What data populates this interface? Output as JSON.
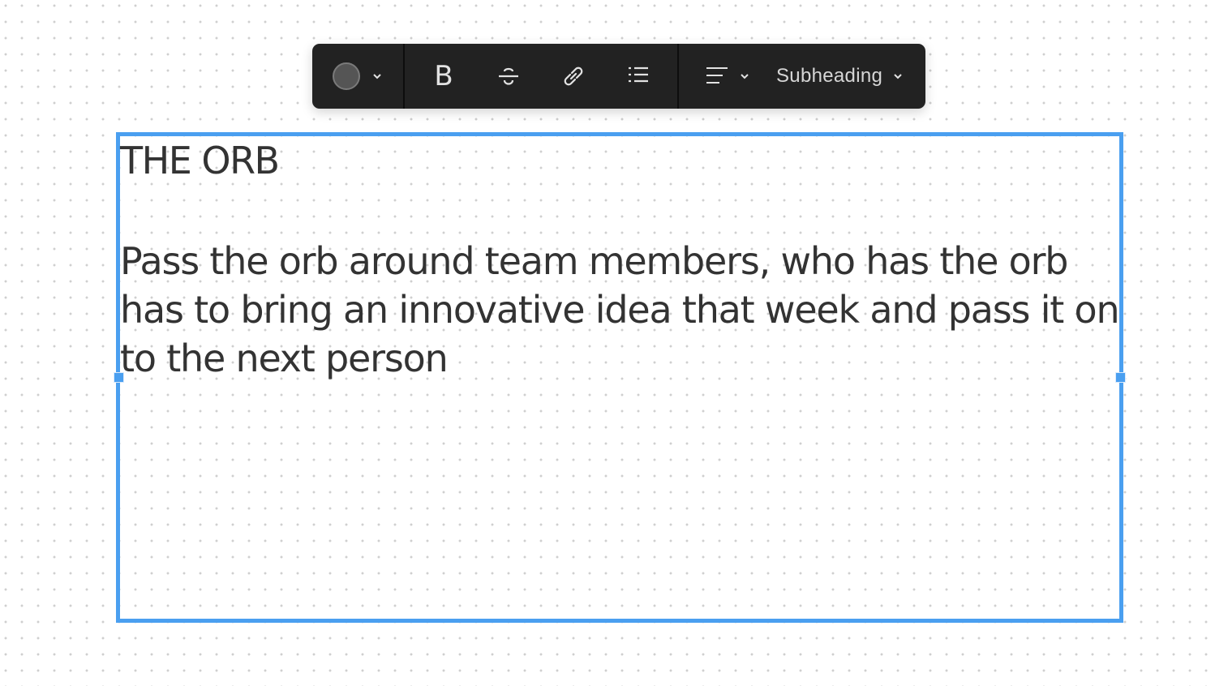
{
  "toolbar": {
    "color_picker": {
      "icon": "color-swatch",
      "color": "#555555"
    },
    "buttons": [
      {
        "name": "bold",
        "icon": "bold-icon",
        "glyph": "B"
      },
      {
        "name": "strikethrough",
        "icon": "strikethrough-icon"
      },
      {
        "name": "link",
        "icon": "link-icon"
      },
      {
        "name": "bullet-list",
        "icon": "bulleted-list-icon"
      }
    ],
    "alignment": {
      "icon": "align-left-icon"
    },
    "text_style": {
      "selected": "Subheading"
    }
  },
  "canvas": {
    "selection_color": "#4a9ff0",
    "text_box": {
      "heading": "THE ORB",
      "paragraph": "Pass the orb around team members, who has the orb has to bring an innovative idea that week and pass it on to the next person"
    }
  }
}
